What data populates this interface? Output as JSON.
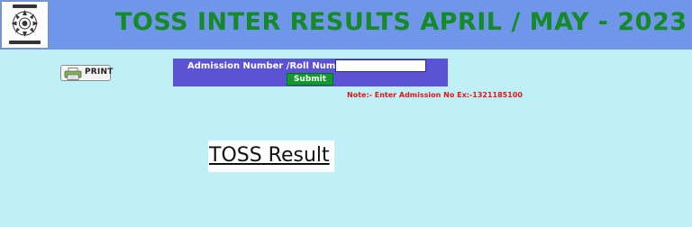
{
  "header": {
    "title": "TOSS INTER RESULTS APRIL / MAY - 2023",
    "title_color": "#148a28",
    "background": "#6f96e8",
    "logo_icon": "toss-emblem-icon"
  },
  "print_button": {
    "label": "PRINT",
    "icon": "printer-icon"
  },
  "form": {
    "label": "Admission Number /Roll Number  :",
    "input_value": "",
    "input_placeholder": "",
    "submit_label": "Submit",
    "panel_color": "#5b53d6",
    "submit_color": "#129a2c"
  },
  "note": {
    "text": "Note:- Enter Admission No Ex:-1321185100",
    "color": "#e01818"
  },
  "result": {
    "heading": "TOSS Result"
  },
  "page": {
    "background": "#bff0f8"
  }
}
